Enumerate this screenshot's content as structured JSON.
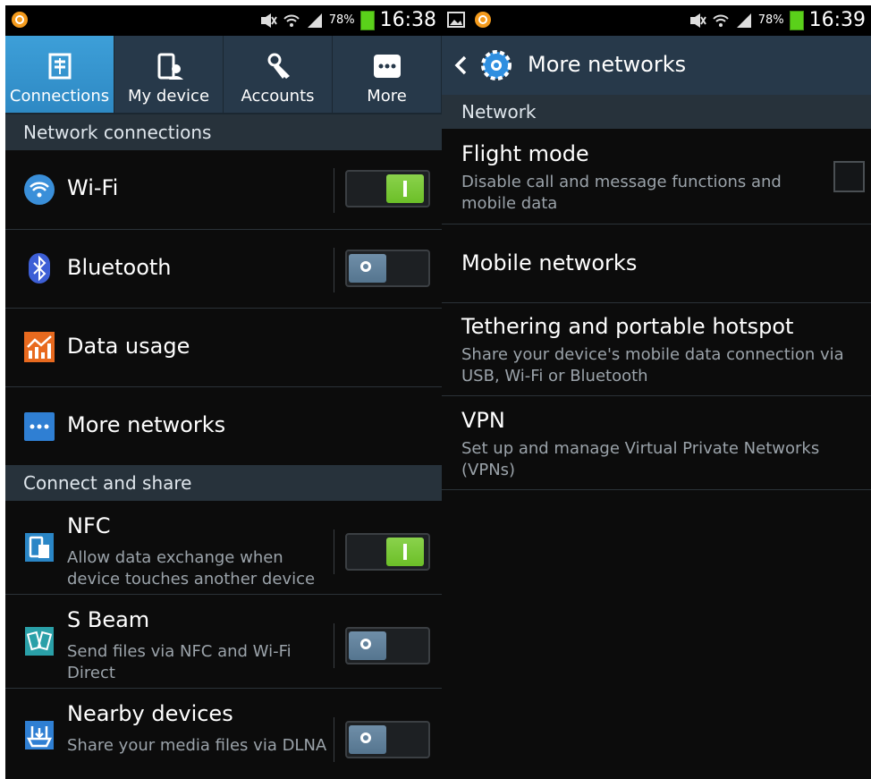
{
  "left": {
    "status": {
      "battery": "78%",
      "time": "16:38"
    },
    "tabs": [
      {
        "label": "Connections",
        "icon": "connections-icon",
        "active": true
      },
      {
        "label": "My device",
        "icon": "my-device-icon",
        "active": false
      },
      {
        "label": "Accounts",
        "icon": "accounts-icon",
        "active": false
      },
      {
        "label": "More",
        "icon": "more-icon",
        "active": false
      }
    ],
    "section1": "Network connections",
    "wifi": {
      "title": "Wi-Fi",
      "state": "on"
    },
    "bluetooth": {
      "title": "Bluetooth",
      "state": "off"
    },
    "data_usage": {
      "title": "Data usage"
    },
    "more_networks": {
      "title": "More networks"
    },
    "section2": "Connect and share",
    "nfc": {
      "title": "NFC",
      "sub": "Allow data exchange when device touches another device",
      "state": "on"
    },
    "sbeam": {
      "title": "S Beam",
      "sub": "Send files via NFC and Wi-Fi Direct",
      "state": "off"
    },
    "nearby": {
      "title": "Nearby devices",
      "sub": "Share your media files via DLNA",
      "state": "off"
    }
  },
  "right": {
    "status": {
      "battery": "78%",
      "time": "16:39"
    },
    "title": "More networks",
    "section": "Network",
    "flight": {
      "title": "Flight mode",
      "sub": "Disable call and message functions and mobile data",
      "checked": false
    },
    "mobile": {
      "title": "Mobile networks"
    },
    "tethering": {
      "title": "Tethering and portable hotspot",
      "sub": "Share your device's mobile data connection via USB, Wi-Fi or Bluetooth"
    },
    "vpn": {
      "title": "VPN",
      "sub": "Set up and manage Virtual Private Networks (VPNs)"
    }
  },
  "colors": {
    "accent": "#3d9fd8",
    "toggle_on": "#7cc93a",
    "header_bg": "#27394a",
    "section_bg": "#27323b"
  }
}
